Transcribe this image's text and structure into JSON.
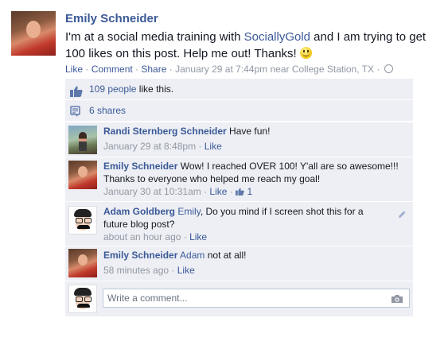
{
  "post": {
    "author": "Emily Schneider",
    "text_before_link": "I'm at a social media training with ",
    "link_text": "SociallyGold",
    "text_after_link": " and I am trying to get 100 likes on this post. Help me out! Thanks! ",
    "meta": {
      "like": "Like",
      "comment": "Comment",
      "share": "Share",
      "separator": " · ",
      "timestamp": "January 29 at 7:44pm near College Station, TX"
    }
  },
  "feedback": {
    "likes_link": "109 people",
    "likes_suffix": " like this.",
    "shares": "6 shares"
  },
  "comments": [
    {
      "author": "Randi Sternberg Schneider",
      "text": " Have fun!",
      "time": "January 29 at 8:48pm",
      "like_label": "Like"
    },
    {
      "author": "Emily Schneider",
      "text": " Wow! I reached OVER 100! Y'all are so awesome!!! Thanks to everyone who helped me reach my goal!",
      "time": "January 30 at 10:31am",
      "like_label": "Like",
      "like_count": "1"
    },
    {
      "author": "Adam Goldberg",
      "mention": "Emily",
      "text": ", Do you mind if I screen shot this for a future blog post?",
      "time": "about an hour ago",
      "like_label": "Like"
    },
    {
      "author": "Emily Schneider",
      "mention": "Adam",
      "text": " not at all!",
      "time": "58 minutes ago",
      "like_label": "Like"
    }
  ],
  "composer": {
    "placeholder": "Write a comment..."
  },
  "icons": {
    "like": "thumbs-up-icon",
    "share": "share-icon",
    "privacy": "globe-icon",
    "edit": "pencil-icon",
    "photo": "camera-icon",
    "emoticon": "smiley-icon"
  },
  "colors": {
    "link": "#3b5998",
    "feedback_bg": "#edeff4",
    "meta_text": "#9197a3"
  }
}
